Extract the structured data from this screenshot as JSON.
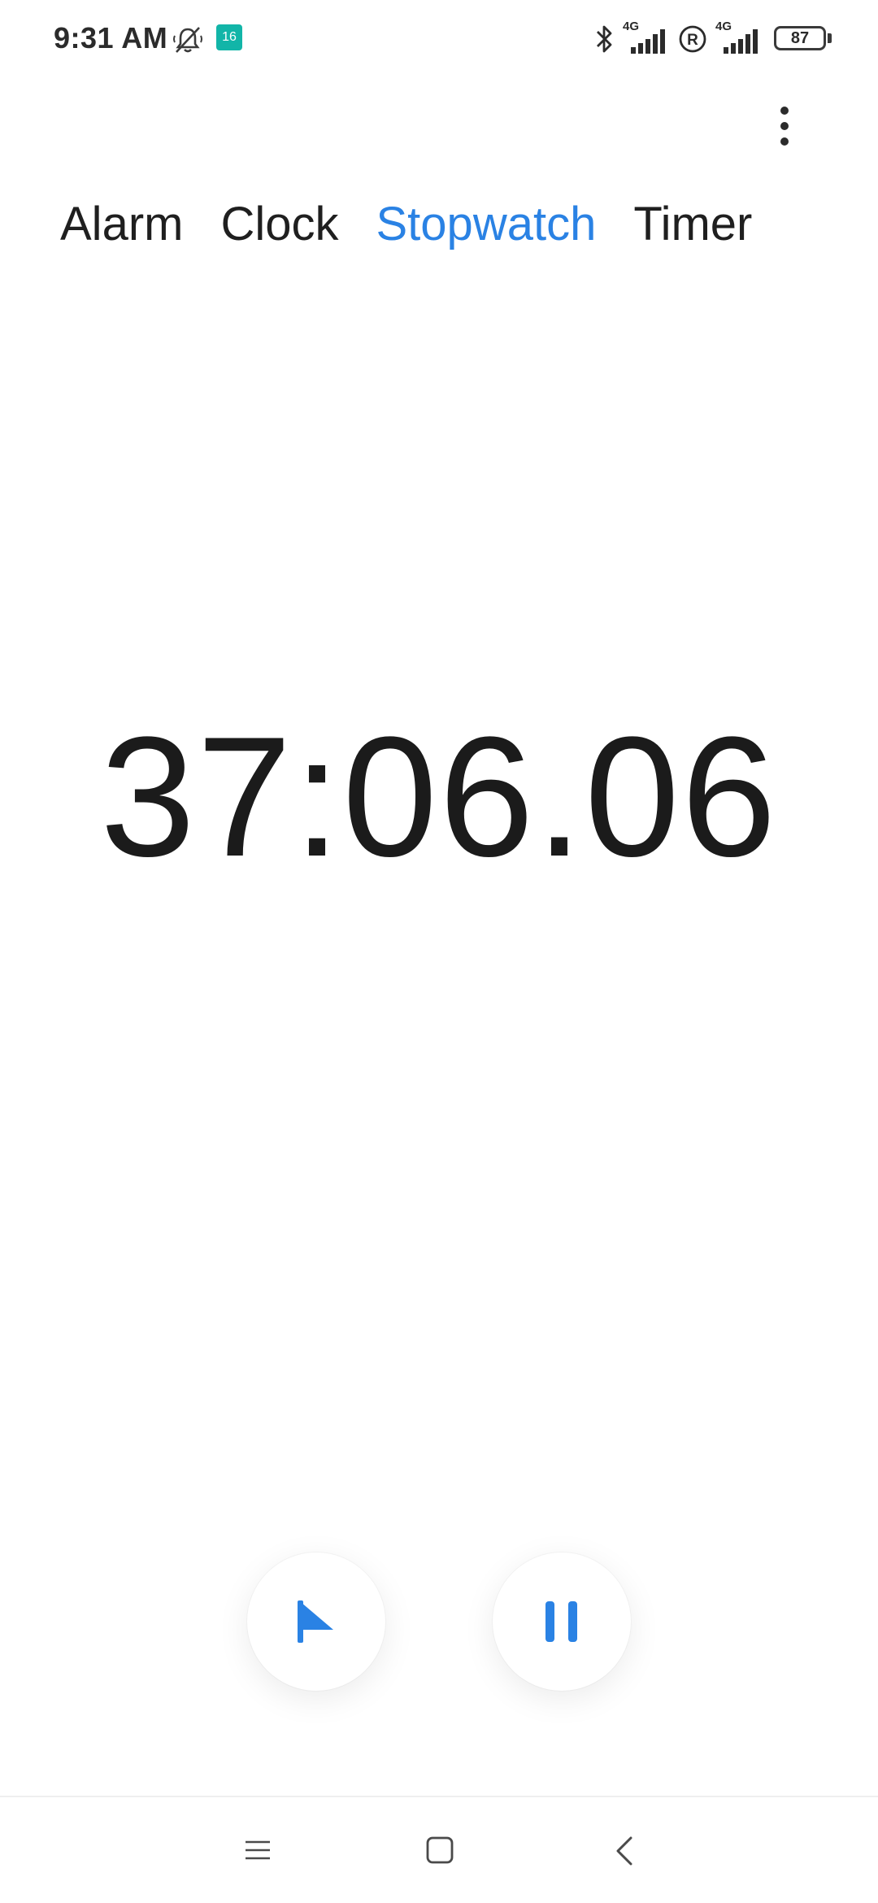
{
  "status_bar": {
    "time": "9:31 AM",
    "app_badge_text": "16",
    "network_1_label": "4G",
    "network_2_label": "4G",
    "battery_level": "87",
    "icons": [
      "mute-icon",
      "app-badge-icon",
      "bluetooth-icon",
      "signal-icon",
      "roaming-icon",
      "signal-icon",
      "battery-icon"
    ]
  },
  "header": {
    "more_menu_icon": "more-vertical-icon"
  },
  "tabs": [
    {
      "label": "Alarm",
      "active": false
    },
    {
      "label": "Clock",
      "active": false
    },
    {
      "label": "Stopwatch",
      "active": true
    },
    {
      "label": "Timer",
      "active": false
    }
  ],
  "stopwatch": {
    "elapsed": "37:06.06"
  },
  "controls": {
    "lap_icon": "flag-icon",
    "pause_icon": "pause-icon"
  },
  "nav_bar": {
    "icons": [
      "recents-icon",
      "home-icon",
      "back-icon"
    ]
  },
  "colors": {
    "accent": "#2a82e4",
    "text": "#1f1f1f",
    "background": "#ffffff"
  }
}
